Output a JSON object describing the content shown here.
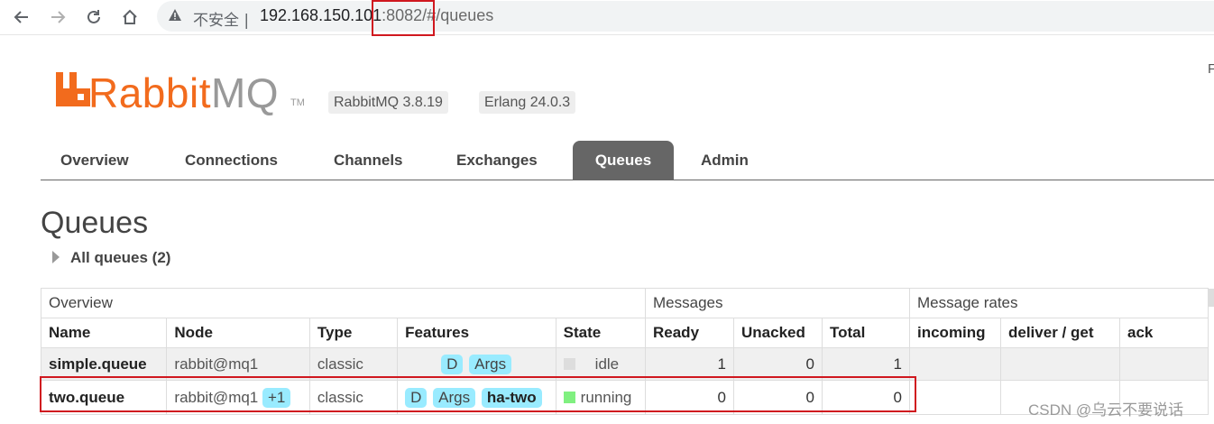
{
  "browser": {
    "security_label": "不安全 |",
    "url_host": "192.168.150.101",
    "url_rest": ":8082/#/queues",
    "cut_off_char": "F"
  },
  "logo": {
    "word_a": "Rabbit",
    "word_b": "MQ",
    "tm": "TM"
  },
  "versions": [
    "RabbitMQ 3.8.19",
    "Erlang 24.0.3"
  ],
  "tabs": [
    "Overview",
    "Connections",
    "Channels",
    "Exchanges",
    "Queues",
    "Admin"
  ],
  "active_tab": "Queues",
  "page": {
    "title": "Queues",
    "section": "All queues (2)"
  },
  "table": {
    "groups": [
      "Overview",
      "Messages",
      "Message rates"
    ],
    "columns": [
      "Name",
      "Node",
      "Type",
      "Features",
      "State",
      "Ready",
      "Unacked",
      "Total",
      "incoming",
      "deliver / get",
      "ack"
    ],
    "rows": [
      {
        "name": "simple.queue",
        "node": "rabbit@mq1",
        "node_extra": "",
        "type": "classic",
        "features": [
          "D",
          "Args"
        ],
        "policy": "",
        "state": "idle",
        "ready": "1",
        "unacked": "0",
        "total": "1"
      },
      {
        "name": "two.queue",
        "node": "rabbit@mq1",
        "node_extra": "+1",
        "type": "classic",
        "features": [
          "D",
          "Args"
        ],
        "policy": "ha-two",
        "state": "running",
        "ready": "0",
        "unacked": "0",
        "total": "0"
      }
    ]
  },
  "watermark": "CSDN @乌云不要说话",
  "colors": {
    "brand_orange": "#f26b1d",
    "tag_blue": "#99ebff",
    "running_green": "#80f080",
    "highlight_red": "#d0181f"
  }
}
